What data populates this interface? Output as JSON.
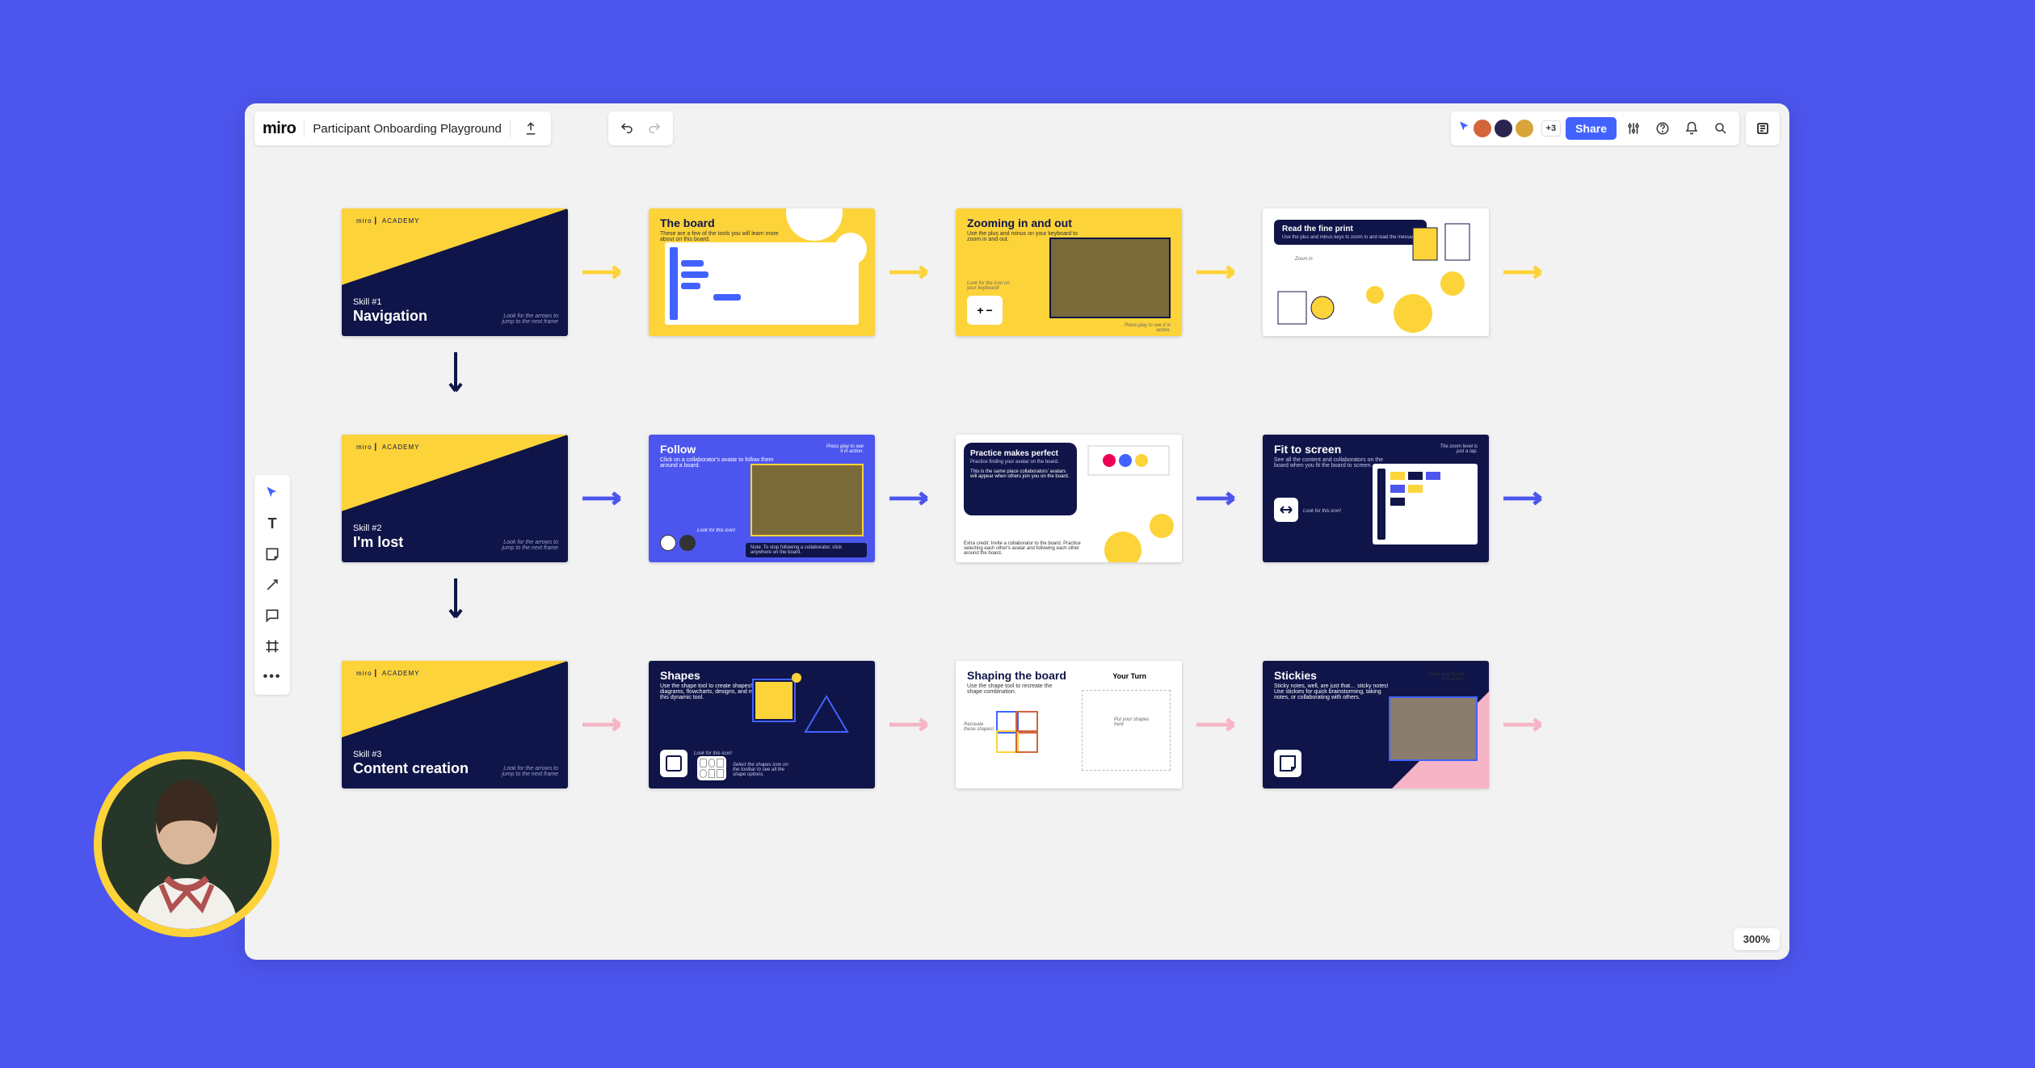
{
  "app": {
    "logo": "miro",
    "board_title": "Participant Onboarding Playground"
  },
  "topbar": {
    "share_label": "Share",
    "plus_count": "+3"
  },
  "zoom": {
    "level": "300%"
  },
  "rows": [
    {
      "arrow_color": "#FDD33A",
      "title_card": {
        "miro": "miro",
        "academy": "ACADEMY",
        "skill_label": "Skill #1",
        "skill_name": "Navigation",
        "hint": "Look for the arrows to jump to the next frame"
      },
      "cards": [
        {
          "title": "The board",
          "subtitle": "These are a few of the tools you will learn more about on this board."
        },
        {
          "title": "Zooming in and out",
          "subtitle": "Use the plus and minus on your keyboard to zoom in and out.",
          "hint_left": "Look for the icon on your keyboard!",
          "hint_right": "Press play to see it in action."
        },
        {
          "title": "Read the fine print",
          "subtitle": "Use the plus and minus keys to zoom in and read the message.",
          "zoom_label": "Zoom in"
        }
      ]
    },
    {
      "arrow_color": "#4C56EE",
      "title_card": {
        "miro": "miro",
        "academy": "ACADEMY",
        "skill_label": "Skill #2",
        "skill_name": "I'm lost",
        "hint": "Look for the arrows to jump to the next frame"
      },
      "cards": [
        {
          "title": "Follow",
          "subtitle": "Click on a collaborator's avatar to follow them around a board.",
          "hint_left": "Look for this icon!",
          "hint_top": "Press play to see it in action.",
          "note": "Note: To stop following a collaborator, click anywhere on the board."
        },
        {
          "title": "Practice makes perfect",
          "subtitle": "Practice finding your avatar on the board.",
          "body": "This is the same place collaborators' avatars will appear when others join you on the board.",
          "extra": "Extra credit: Invite a collaborator to the board. Practice selecting each other's avatar and following each other around the board."
        },
        {
          "title": "Fit to screen",
          "subtitle": "See all the content and collaborators on the board when you fit the board to screen.",
          "hint_left": "Look for this icon!",
          "hint_right": "The zoom level is just a tap."
        }
      ]
    },
    {
      "arrow_color": "#F5B5C6",
      "title_card": {
        "miro": "miro",
        "academy": "ACADEMY",
        "skill_label": "Skill #3",
        "skill_name": "Content creation",
        "hint": "Look for the arrows to jump to the next frame"
      },
      "cards": [
        {
          "title": "Shapes",
          "subtitle": "Use the shape tool to create shapes! Create diagrams, flowcharts, designs, and more with this dynamic tool.",
          "hint_left": "Look for this icon!",
          "hint_right": "Select the shapes icon on the toolbar to see all the shape options."
        },
        {
          "title": "Shaping the board",
          "subtitle": "Use the shape tool to recreate the shape combination.",
          "left_label": "Recreate these shapes!",
          "right_label": "Your Turn",
          "right_hint": "Put your shapes here"
        },
        {
          "title": "Stickies",
          "subtitle": "Sticky notes, well, are just that… sticky notes! Use stickies for quick brainstorming, taking notes, or collaborating with others.",
          "hint_right": "Press play to see it in action."
        }
      ]
    }
  ],
  "tools": [
    "select",
    "text",
    "sticky",
    "line",
    "comment",
    "frame",
    "more"
  ]
}
